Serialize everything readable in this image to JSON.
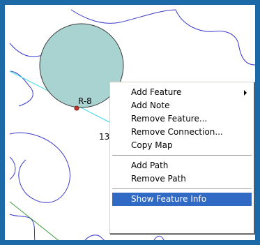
{
  "map": {
    "feature_label": "R-8",
    "partial_label": "13"
  },
  "context_menu": {
    "items": [
      {
        "label": "Add Feature",
        "has_submenu": true
      },
      {
        "label": "Add Note"
      },
      {
        "label": "Remove Feature..."
      },
      {
        "label": "Remove Connection..."
      },
      {
        "label": "Copy Map"
      },
      {
        "label": "Add Path"
      },
      {
        "label": "Remove Path"
      },
      {
        "label": "Show Feature Info",
        "selected": true
      }
    ]
  },
  "colors": {
    "frame_border": "#1c69a8",
    "feature_fill": "#a9d3d1",
    "contour_line": "#3a3acb",
    "cyan_line": "#39d9e6",
    "green_line": "#3c9a3c",
    "selection": "#316ac5"
  }
}
